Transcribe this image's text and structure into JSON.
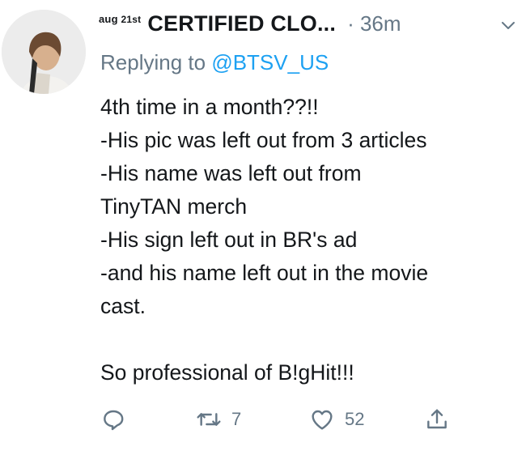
{
  "header": {
    "date_month": "aug",
    "date_day": "21",
    "date_suffix": "st",
    "name": "CERTIFIED CLO...",
    "time": "· 36m"
  },
  "reply": {
    "prefix": "Replying to",
    "handle": "@BTSV_US"
  },
  "body_lines": [
    "4th time in a month??!!",
    "-His pic was left out from 3 articles",
    "-His name was left out from",
    "TinyTAN merch",
    "-His sign left out in BR's ad",
    "-and his name left out in the movie",
    "cast.",
    "",
    "So professional of B!gHit!!!"
  ],
  "actions": {
    "reply_count": "",
    "retweet_count": "7",
    "like_count": "52"
  },
  "icons": {
    "reply": "reply-icon",
    "retweet": "retweet-icon",
    "like": "heart-icon",
    "share": "share-icon",
    "caret": "chevron-down-icon"
  },
  "colors": {
    "text": "#14171a",
    "secondary": "#657786",
    "link": "#1da1f2"
  }
}
